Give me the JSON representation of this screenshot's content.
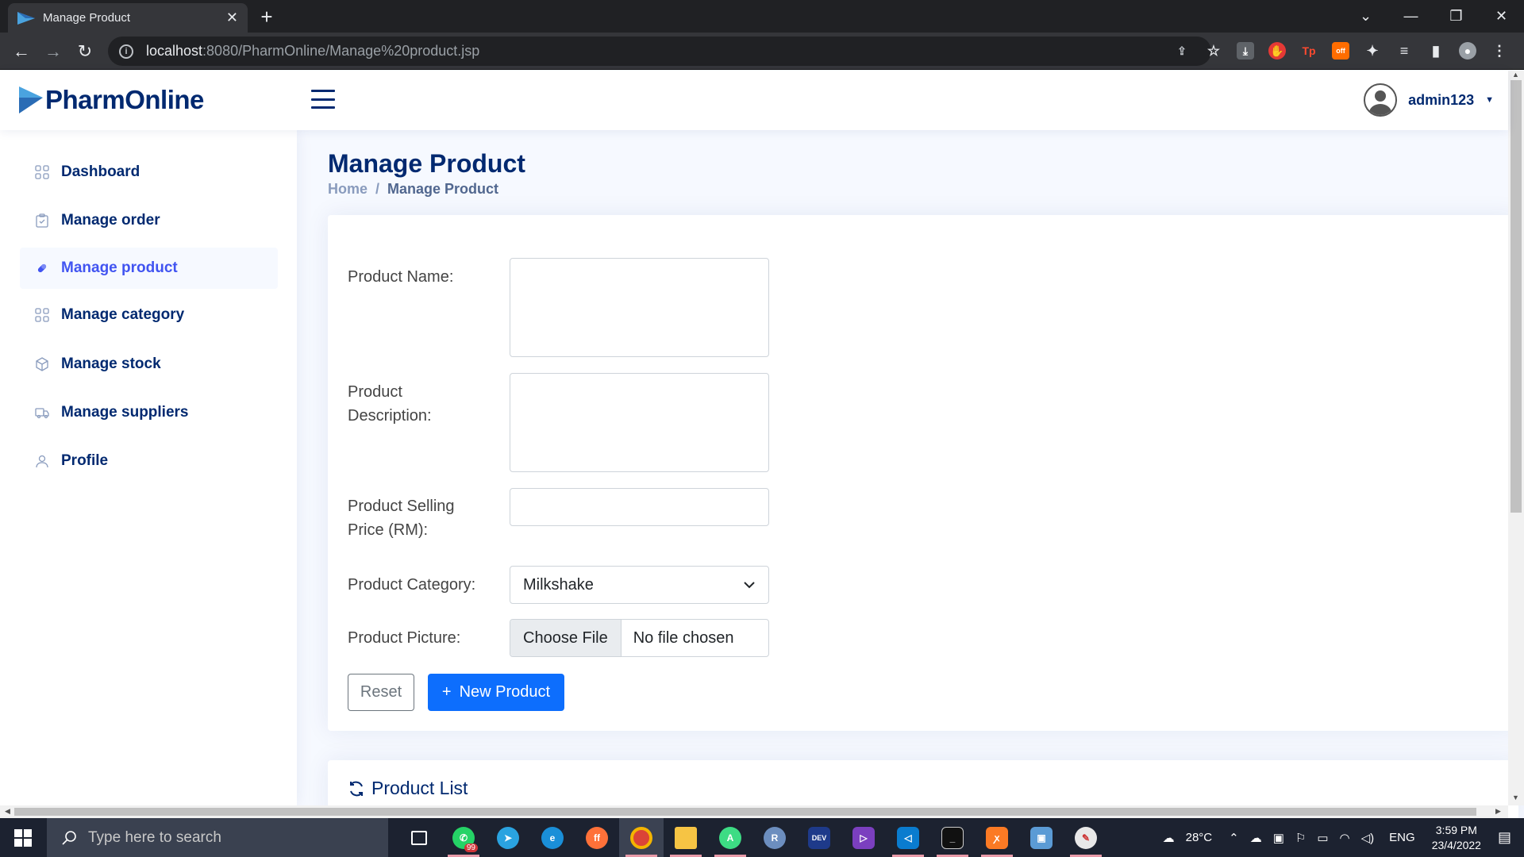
{
  "browser": {
    "tab_title": "Manage Product",
    "url_host": "localhost",
    "url_path": ":8080/PharmOnline/Manage%20product.jsp"
  },
  "app": {
    "brand": "PharmOnline",
    "username": "admin123"
  },
  "sidebar": {
    "items": [
      {
        "label": "Dashboard",
        "icon": "grid-icon"
      },
      {
        "label": "Manage order",
        "icon": "clipboard-icon"
      },
      {
        "label": "Manage product",
        "icon": "capsule-icon",
        "active": true
      },
      {
        "label": "Manage category",
        "icon": "grid-icon"
      },
      {
        "label": "Manage stock",
        "icon": "box-icon"
      },
      {
        "label": "Manage suppliers",
        "icon": "truck-icon"
      },
      {
        "label": "Profile",
        "icon": "person-icon"
      }
    ]
  },
  "page": {
    "title": "Manage Product",
    "breadcrumb_home": "Home",
    "breadcrumb_sep": "/",
    "breadcrumb_current": "Manage Product"
  },
  "form": {
    "name_label": "Product Name:",
    "name_value": "",
    "desc_label_1": "Product",
    "desc_label_2": "Description:",
    "desc_value": "",
    "price_label_1": "Product Selling",
    "price_label_2": "Price (RM):",
    "price_value": "",
    "category_label": "Product Category:",
    "category_value": "Milkshake",
    "picture_label": "Product Picture:",
    "choose_file": "Choose File",
    "no_file": "No file chosen",
    "reset_label": "Reset",
    "new_label": "New Product",
    "new_icon": "+"
  },
  "product_list": {
    "title": "Product List"
  },
  "taskbar": {
    "search_placeholder": "Type here to search",
    "whatsapp_badge": "99",
    "weather": "28°C",
    "lang": "ENG",
    "time": "3:59 PM",
    "date": "23/4/2022"
  },
  "colors": {
    "brand": "#012970",
    "accent": "#4154f1",
    "primary_button": "#0d6efd"
  }
}
